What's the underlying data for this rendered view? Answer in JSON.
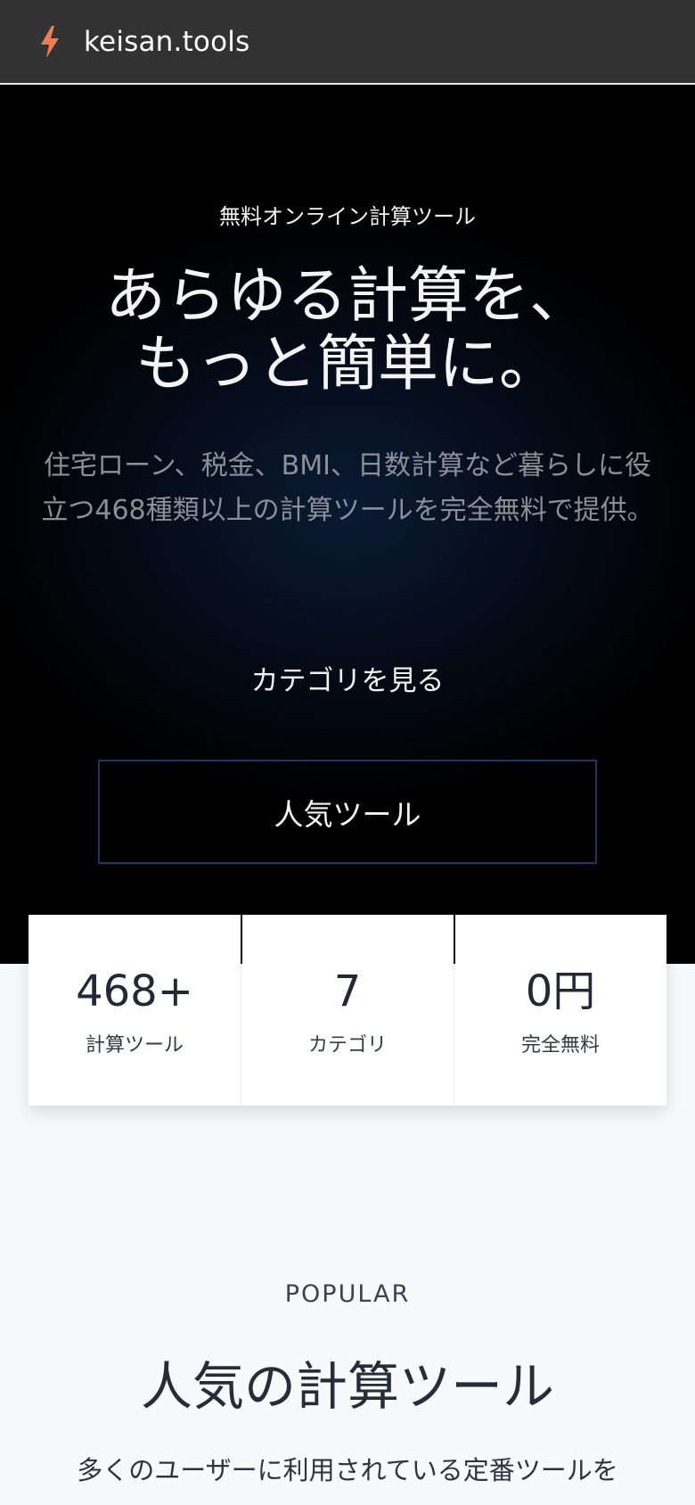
{
  "header": {
    "logo_icon": "lightning-bolt-icon",
    "logo_text": "keisan.tools",
    "accent_color": "#f47b4f"
  },
  "hero": {
    "eyebrow": "無料オンライン計算ツール",
    "headline_line1": "あらゆる計算を、",
    "headline_line2": "もっと簡単に。",
    "subtitle": "住宅ローン、税金、BMI、日数計算など暮らしに役立つ468種類以上の計算ツールを完全無料で提供。",
    "category_link": "カテゴリを見る",
    "popular_button": "人気ツール"
  },
  "stats": [
    {
      "value": "468+",
      "label": "計算ツール"
    },
    {
      "value": "7",
      "label": "カテゴリ"
    },
    {
      "value": "0円",
      "label": "完全無料"
    }
  ],
  "popular_section": {
    "eyebrow": "POPULAR",
    "title": "人気の計算ツール",
    "description": "多くのユーザーに利用されている定番ツールを"
  }
}
